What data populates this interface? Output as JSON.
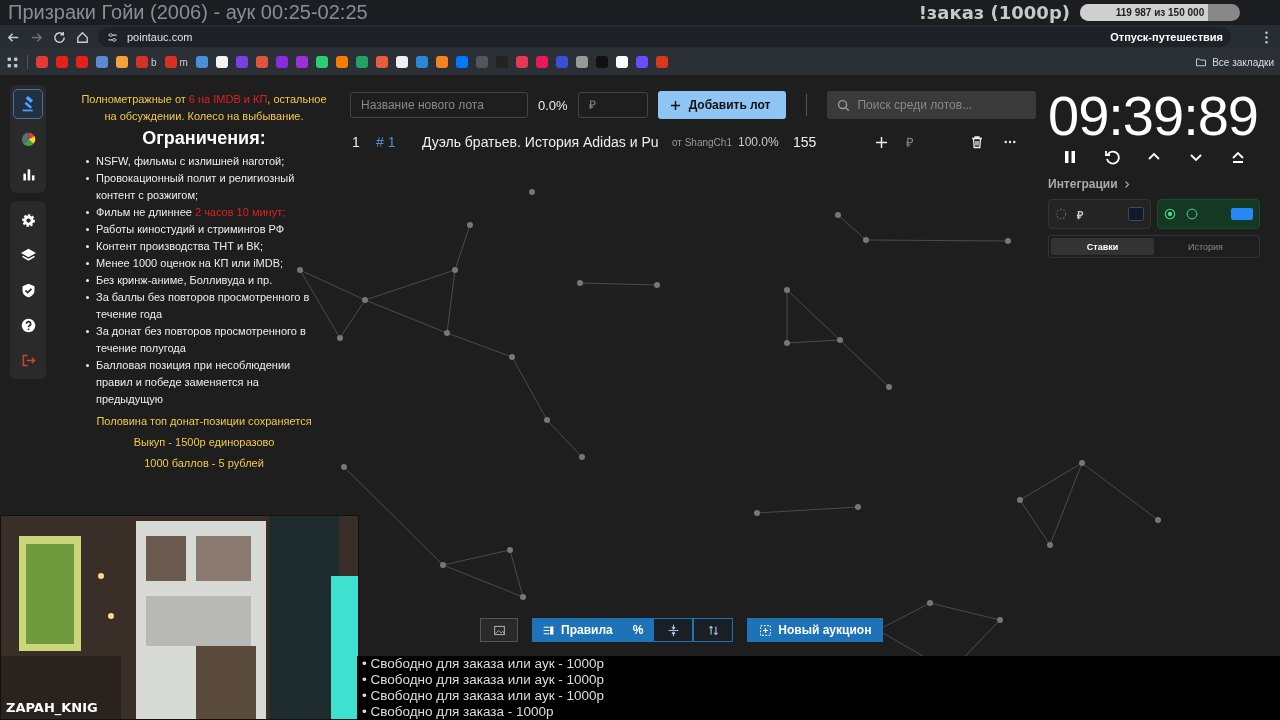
{
  "stream_overlay": {
    "title": "Призраки Гойи (2006) - аук 00:25-02:25",
    "order_label": "!заказ (1000р)",
    "goal": {
      "reading": "119 987  из 150 000",
      "level": 0.8
    },
    "goal_name": "Отпуск-путешествия",
    "streamer_name": "ZAPAH_KNIG",
    "queue": [
      "• Свободно для заказа или аук - 1000р",
      "• Свободно для заказа или аук - 1000р",
      "• Свободно для заказа или аук - 1000р",
      "• Свободно для заказа - 1000р"
    ]
  },
  "browser": {
    "url": "pointauc.com",
    "bookmark_labels": [
      "b",
      "m"
    ],
    "all_bookmarks": "Все закладки"
  },
  "sidebar": {
    "items": [
      {
        "kind": "gavel",
        "selected": true
      },
      {
        "kind": "wheel",
        "selected": false
      },
      {
        "kind": "stats",
        "selected": false
      },
      {
        "kind": "settings",
        "selected": false
      },
      {
        "kind": "layers",
        "selected": false
      },
      {
        "kind": "shield",
        "selected": false
      },
      {
        "kind": "help",
        "selected": false
      },
      {
        "kind": "logout",
        "selected": false
      }
    ]
  },
  "rules": {
    "intro": [
      {
        "text": "Полнометражные от ",
        "highlight": false
      },
      {
        "text": "6 на IMDB и КП",
        "highlight": true
      },
      {
        "text": ", остальное на обсуждении. Колесо на выбывание.",
        "highlight": false
      }
    ],
    "heading": "Ограничения:",
    "items": [
      [
        {
          "text": "NSFW, фильмы с излишней наготой;",
          "highlight": false
        }
      ],
      [
        {
          "text": "Провокационный полит и религиозный контент с розжигом;",
          "highlight": false
        }
      ],
      [
        {
          "text": "Фильм не длиннее ",
          "highlight": false
        },
        {
          "text": "2 часов 10 минут;",
          "highlight": true
        }
      ],
      [
        {
          "text": "Работы киностудий и стримингов РФ",
          "highlight": false
        }
      ],
      [
        {
          "text": "Контент производства ТНТ и ВК;",
          "highlight": false
        }
      ],
      [
        {
          "text": "Менее 1000 оценок на КП или iMDB;",
          "highlight": false
        }
      ],
      [
        {
          "text": "Без кринж-аниме, Болливуда и пр.",
          "highlight": false
        }
      ],
      [
        {
          "text": "За баллы без повторов просмотренного в течение года",
          "highlight": false
        }
      ],
      [
        {
          "text": "За донат без повторов просмотренного в течение полугода",
          "highlight": false
        }
      ],
      [
        {
          "text": "Балловая позиция при несоблюдении правил и победе заменяется на предыдущую",
          "highlight": false
        }
      ]
    ],
    "notes": [
      "Половина топ донат-позиции сохраняется",
      "Выкуп - 1500р единоразово",
      "1000 баллов - 5 рублей"
    ]
  },
  "lot_form": {
    "name_placeholder": "Название нового лота",
    "percent": "0.0%",
    "amount_placeholder": "₽",
    "add_button": "Добавить лот",
    "search_placeholder": "Поиск среди лотов..."
  },
  "lots": [
    {
      "index": "1",
      "id": "# 1",
      "name": "Дуэль братьев. История Adidas и Pu",
      "author": "от ShangCh1",
      "percent": "100.0%",
      "amount": "155",
      "currency": "₽"
    }
  ],
  "timer": {
    "time": "09:39:89"
  },
  "integrations": {
    "title": "Интеграции",
    "services": [
      {
        "connected": false,
        "currency": "₽"
      },
      {
        "connected": true
      }
    ]
  },
  "tabs": [
    {
      "label": "Ставки",
      "selected": true
    },
    {
      "label": "История",
      "selected": false
    }
  ],
  "toolbar": {
    "rules_button": "Правила",
    "percent_button": "%",
    "new_auction_button": "Новый аукцион"
  }
}
